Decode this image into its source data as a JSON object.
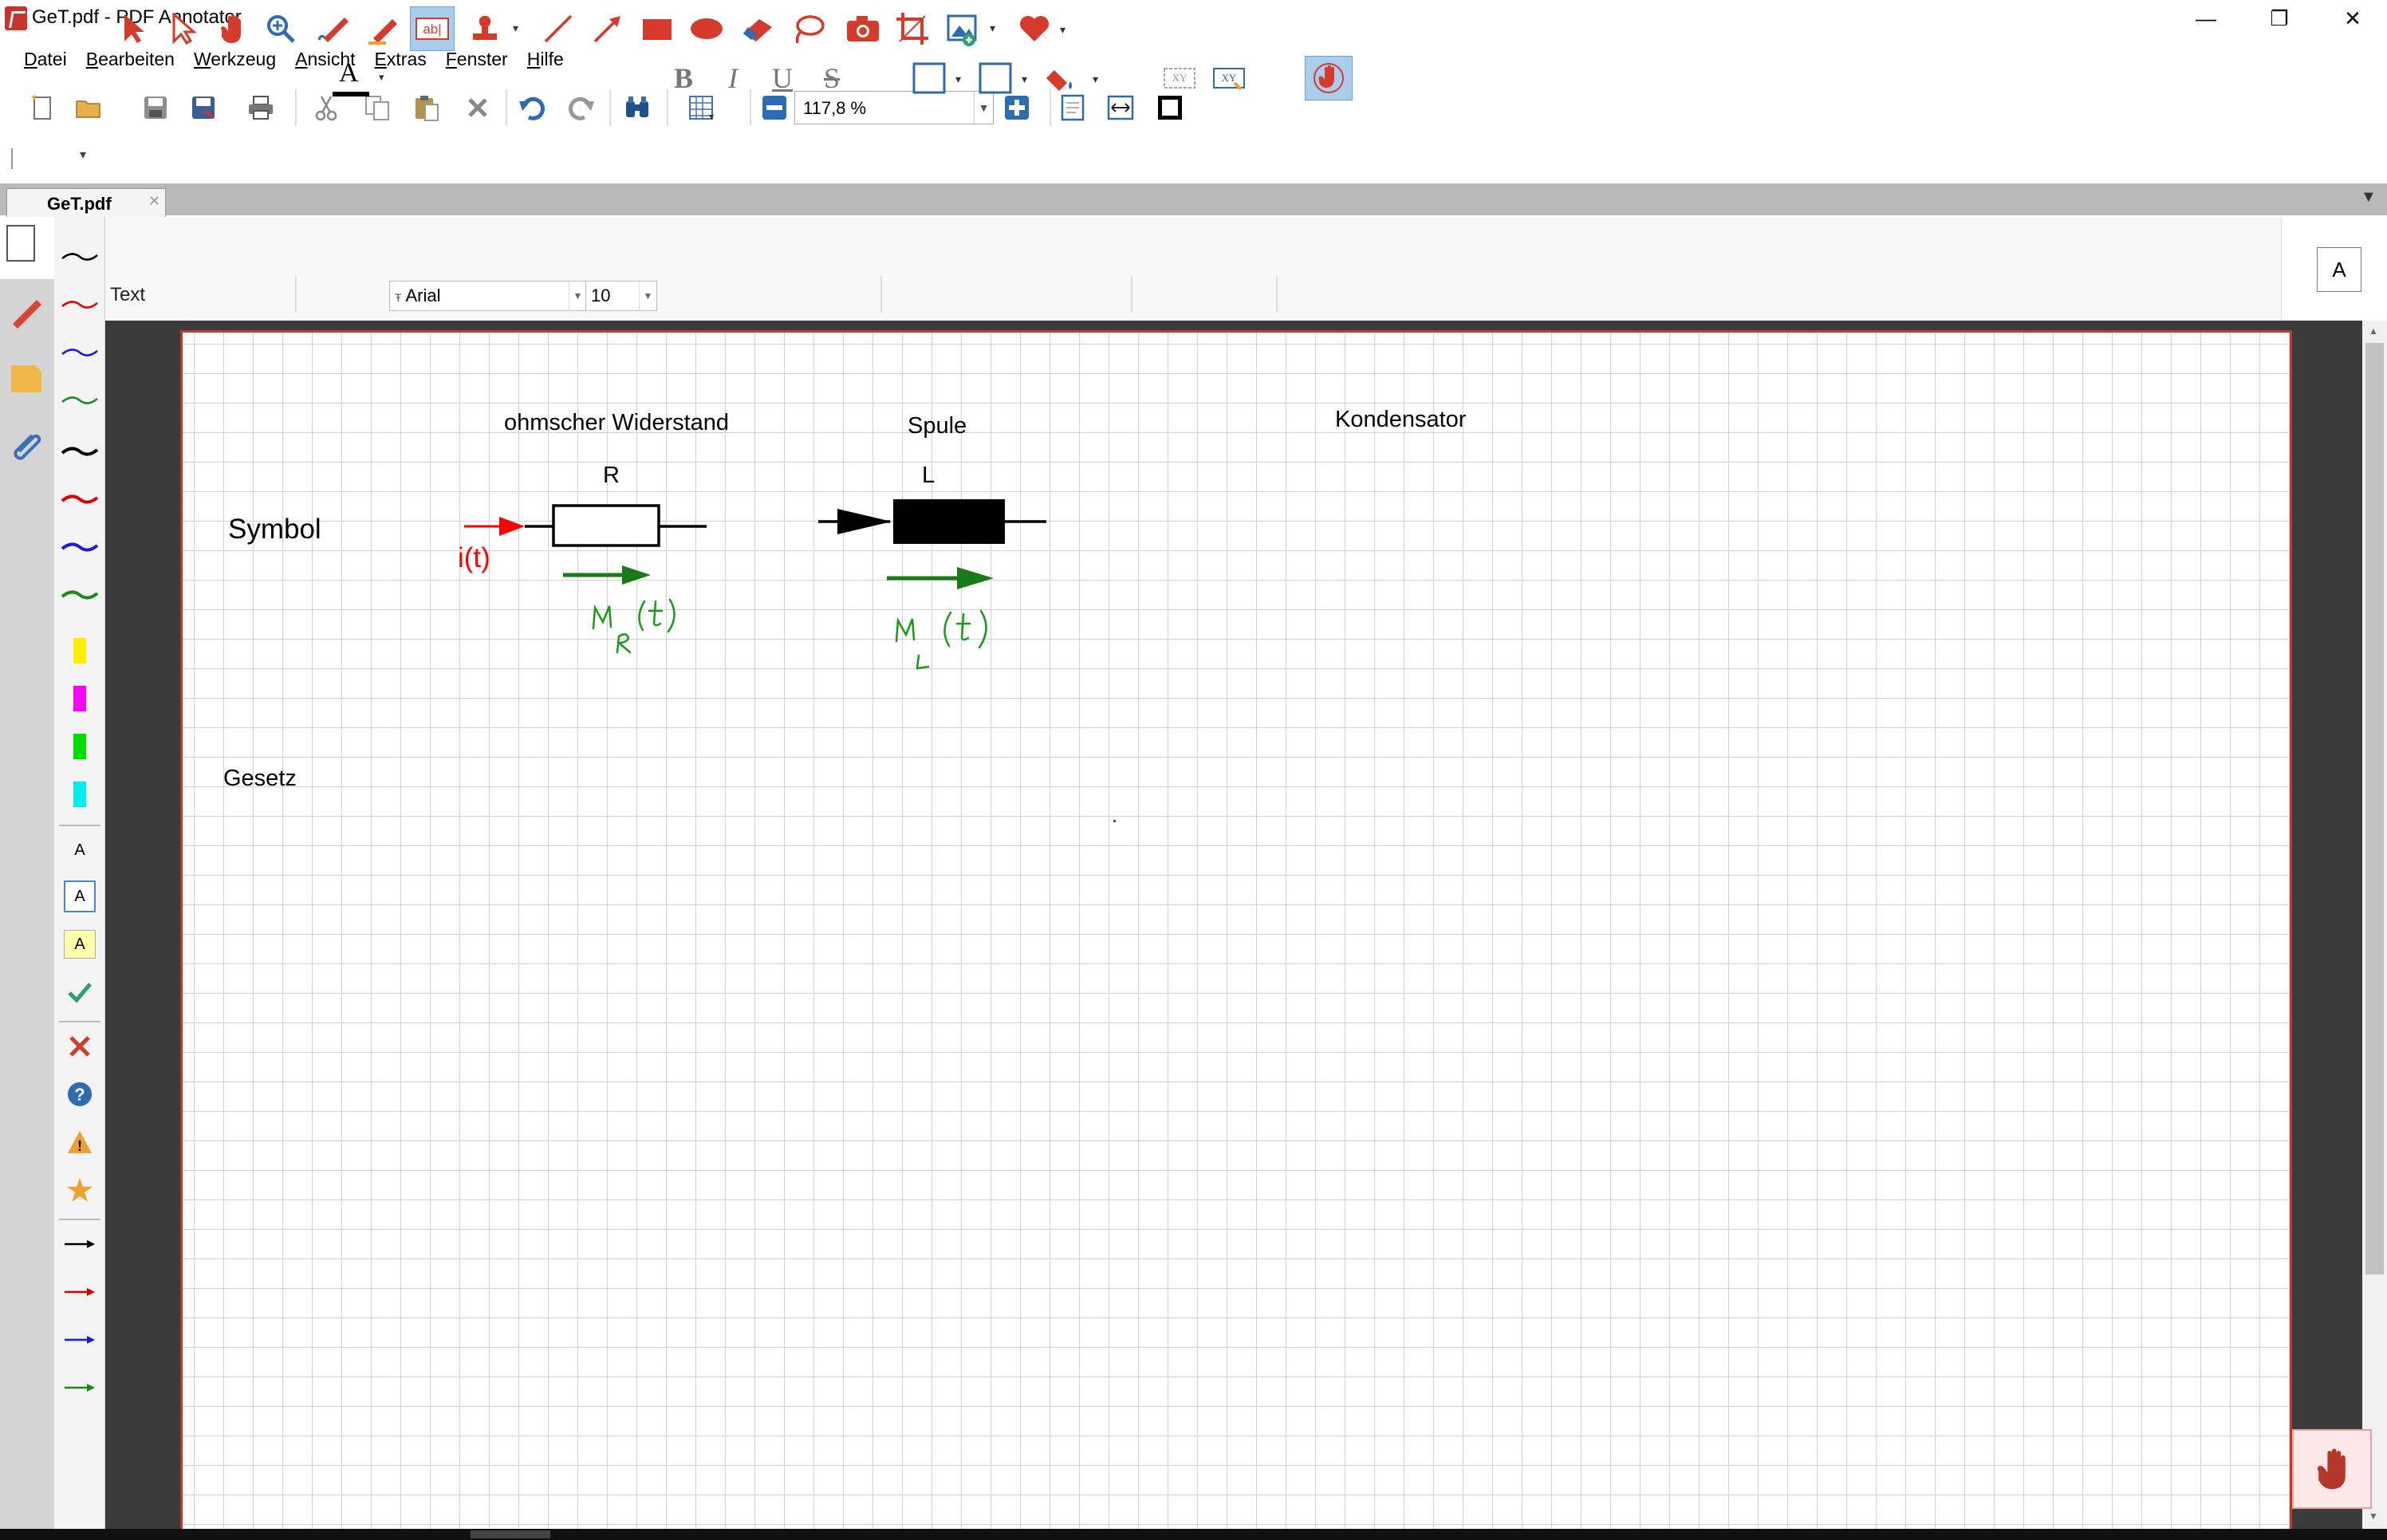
{
  "window": {
    "title": "GeT.pdf - PDF Annotator",
    "controls": {
      "minimize": "—",
      "restore": "❐",
      "close": "✕"
    }
  },
  "menu": [
    {
      "key": "D",
      "rest": "atei"
    },
    {
      "key": "B",
      "rest": "earbeiten"
    },
    {
      "key": "W",
      "rest": "erkzeug"
    },
    {
      "key": "A",
      "rest": "nsicht"
    },
    {
      "key": "E",
      "rest": "xtras"
    },
    {
      "key": "F",
      "rest": "enster"
    },
    {
      "key": "H",
      "rest": "ilfe"
    }
  ],
  "toolbar": {
    "zoom_value": "117,8 %",
    "icons": [
      "new-document-icon",
      "open-folder-icon",
      "save-icon",
      "save-as-icon",
      "print-icon",
      "cut-icon",
      "copy-icon",
      "paste-icon",
      "delete-icon",
      "undo-icon",
      "redo-icon",
      "find-icon",
      "page-layout-icon",
      "zoom-out-icon",
      "zoom-in-icon",
      "fit-page-icon",
      "fit-width-icon",
      "full-screen-icon"
    ]
  },
  "tab": {
    "label": "GeT.pdf",
    "close": "✕"
  },
  "annotation_toolbar": {
    "mode_label": "Text",
    "font_name": "Arial",
    "font_size": "10",
    "bold": "B",
    "italic": "I",
    "underline": "U",
    "strike": "S",
    "text_color_glyph": "A",
    "right_box_label": "A"
  },
  "favorites": {
    "text_styles": [
      "A",
      "A",
      "A"
    ],
    "colors": {
      "black": "#000000",
      "red": "#e00000",
      "blue": "#1a1adb",
      "green": "#1a8a1a",
      "yellow": "#ffee00",
      "magenta": "#ff00ff",
      "lime": "#00dd00",
      "cyan": "#00eeee"
    }
  },
  "document": {
    "labels": {
      "ohmscher": "ohmscher Widerstand",
      "spule": "Spule",
      "kondensator": "Kondensator",
      "symbol": "Symbol",
      "gesetz": "Gesetz",
      "r": "R",
      "l": "L",
      "current": "i(t)"
    },
    "handwriting": {
      "u_r": "uR(t)",
      "u_l": "uL(t)"
    },
    "colors": {
      "page_border": "#c0392b",
      "grid": "#d0d0d0",
      "annot_red": "#ff0000",
      "annot_green": "#1a7a1a"
    }
  }
}
